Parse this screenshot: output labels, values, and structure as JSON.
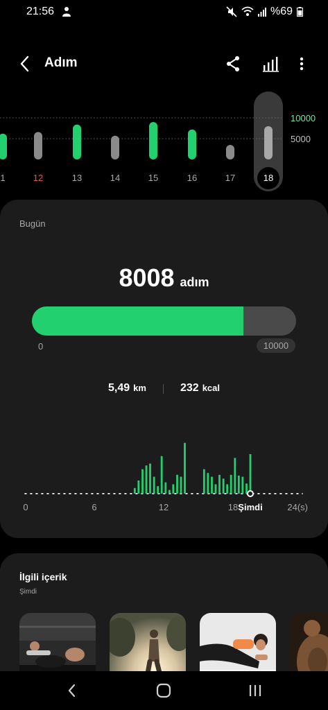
{
  "status_bar": {
    "time": "21:56",
    "battery": "%69",
    "icons": [
      "app-notification-icon",
      "mute-icon",
      "wifi-icon",
      "signal-icon",
      "battery-icon"
    ]
  },
  "header": {
    "title": "Adım",
    "icons": [
      "back-icon",
      "share-icon",
      "chart-icon",
      "more-icon"
    ]
  },
  "week_chart": {
    "days": [
      {
        "label": "1",
        "value": 6200,
        "reached": true,
        "color": "#a8a8a8"
      },
      {
        "label": "12",
        "value": 6600,
        "reached": false,
        "color": "#e0584f"
      },
      {
        "label": "13",
        "value": 8400,
        "reached": true,
        "color": "#a8a8a8"
      },
      {
        "label": "14",
        "value": 5700,
        "reached": false,
        "color": "#a8a8a8"
      },
      {
        "label": "15",
        "value": 9000,
        "reached": true,
        "color": "#a8a8a8"
      },
      {
        "label": "16",
        "value": 7200,
        "reached": true,
        "color": "#a8a8a8"
      },
      {
        "label": "17",
        "value": 3500,
        "reached": false,
        "color": "#a8a8a8"
      },
      {
        "label": "18",
        "value": 8008,
        "reached": false,
        "selected": true,
        "color": "#ffffff"
      }
    ],
    "goal_label": "10000",
    "half_label": "5000",
    "goal": 10000,
    "colors": {
      "reached": "#22d06f",
      "not_reached": "#8a8a8a",
      "selected": "#a8a8a8",
      "goal_label": "#7be0a8",
      "half_label": "#bdbdbd"
    }
  },
  "today": {
    "label": "Bugün",
    "steps": "8008",
    "steps_unit": "adım",
    "progress": 0.8008,
    "progress_min": "0",
    "goal": "10000",
    "distance_value": "5,49",
    "distance_unit": "km",
    "calories_value": "232",
    "calories_unit": "kcal",
    "accent": "#22d06f"
  },
  "hourly_chart": {
    "type": "bar",
    "hours": [
      9,
      9.5,
      10,
      10.5,
      11,
      11.5,
      12,
      12.5,
      13,
      13.5,
      14,
      14.5,
      15,
      15.5,
      16,
      16.5,
      17,
      17.5,
      18,
      18.5,
      19,
      19.5,
      20,
      20.5,
      21
    ],
    "values": [
      15,
      35,
      65,
      75,
      80,
      45,
      20,
      100,
      30,
      10,
      25,
      50,
      45,
      135,
      0,
      0,
      65,
      55,
      45,
      25,
      50,
      40,
      25,
      100,
      0
    ],
    "bar_values": [
      {
        "hour": 9.5,
        "value": 15
      },
      {
        "hour": 9.83,
        "value": 35
      },
      {
        "hour": 10.17,
        "value": 65
      },
      {
        "hour": 10.5,
        "value": 75
      },
      {
        "hour": 10.83,
        "value": 80
      },
      {
        "hour": 11.17,
        "value": 45
      },
      {
        "hour": 11.5,
        "value": 20
      },
      {
        "hour": 11.83,
        "value": 100
      },
      {
        "hour": 12.17,
        "value": 30
      },
      {
        "hour": 12.5,
        "value": 10
      },
      {
        "hour": 12.83,
        "value": 25
      },
      {
        "hour": 13.17,
        "value": 50
      },
      {
        "hour": 13.5,
        "value": 45
      },
      {
        "hour": 13.83,
        "value": 135
      },
      {
        "hour": 15.5,
        "value": 65
      },
      {
        "hour": 15.83,
        "value": 55
      },
      {
        "hour": 16.17,
        "value": 45
      },
      {
        "hour": 16.5,
        "value": 25
      },
      {
        "hour": 16.83,
        "value": 50
      },
      {
        "hour": 17.17,
        "value": 40
      },
      {
        "hour": 17.5,
        "value": 25
      },
      {
        "hour": 17.83,
        "value": 50
      },
      {
        "hour": 18.17,
        "value": 95
      },
      {
        "hour": 18.5,
        "value": 48
      },
      {
        "hour": 18.83,
        "value": 45
      },
      {
        "hour": 19.17,
        "value": 27
      },
      {
        "hour": 19.5,
        "value": 105
      }
    ],
    "x_ticks": [
      "0",
      "6",
      "12",
      "18"
    ],
    "now_label": "Şimdi",
    "end_label": "24(s)",
    "xlim": [
      0,
      24
    ]
  },
  "related": {
    "title": "İlgili içerik",
    "subtitle": "Şimdi"
  },
  "nav": {
    "icons": [
      "nav-back-icon",
      "nav-home-icon",
      "nav-recents-icon"
    ]
  }
}
